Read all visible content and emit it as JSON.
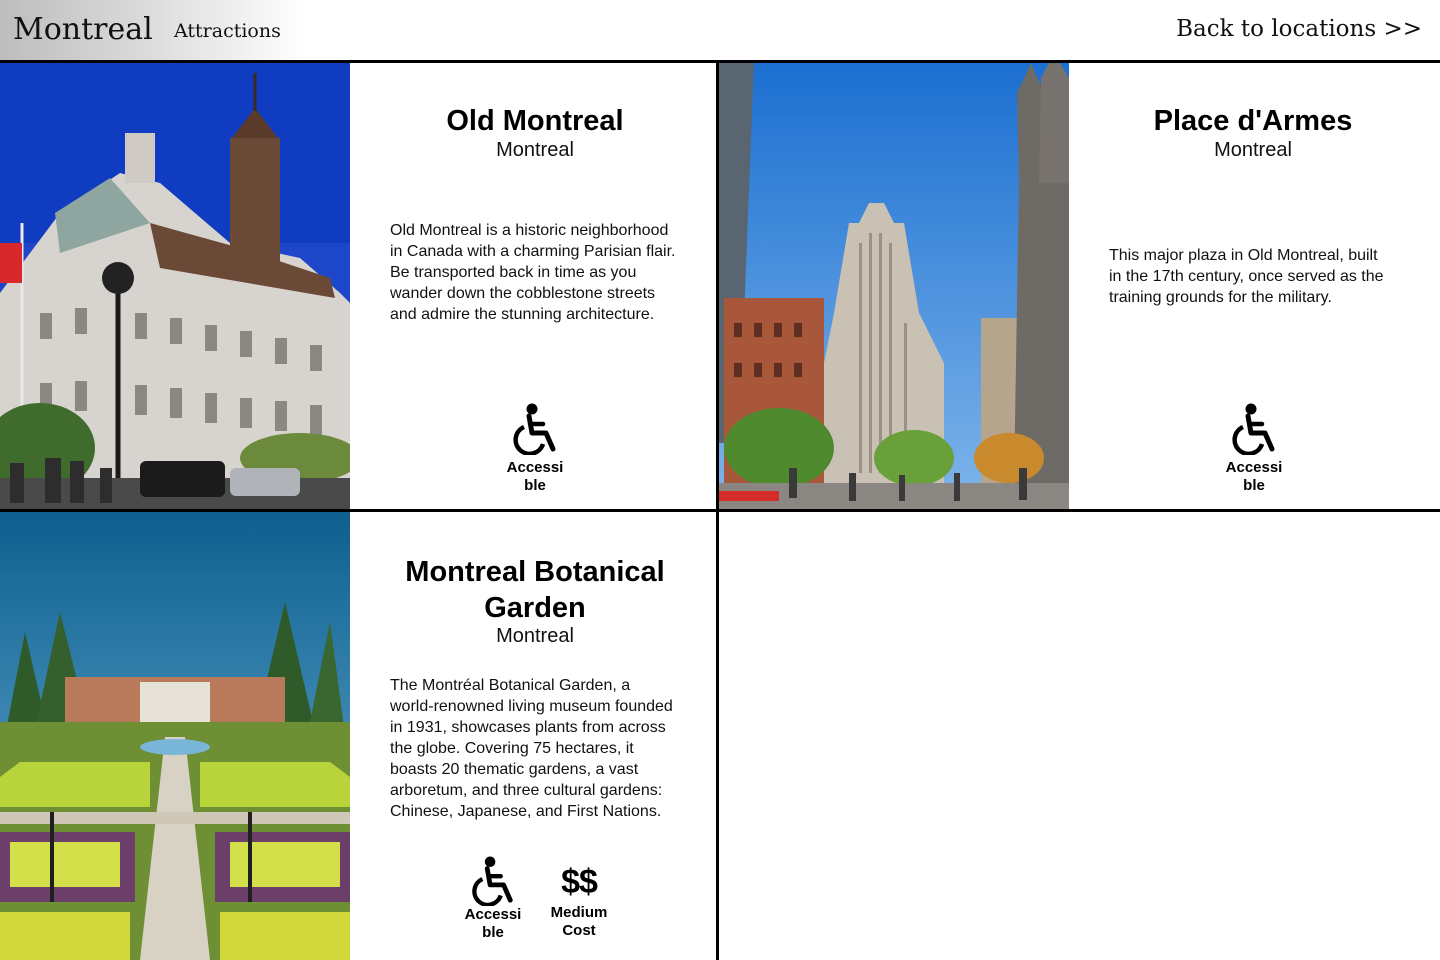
{
  "header": {
    "title": "Montreal",
    "subtitle": "Attractions",
    "back_link": "Back to locations >>"
  },
  "attractions": [
    {
      "title": "Old Montreal",
      "city": "Montreal",
      "description": "Old Montreal is a historic neighborhood in Canada with a charming Parisian flair. Be transported back in time as you wander down the cobblestone streets and admire the stunning architecture.",
      "badges": [
        {
          "icon": "wheelchair-icon",
          "label": "Accessible"
        }
      ]
    },
    {
      "title": "Place d'Armes",
      "city": "Montreal",
      "description": "This major plaza in Old Montreal, built in the 17th century, once served as the training grounds for the military.",
      "badges": [
        {
          "icon": "wheelchair-icon",
          "label": "Accessible"
        }
      ]
    },
    {
      "title": "Montreal Botanical Garden",
      "city": "Montreal",
      "description": "The Montréal Botanical Garden, a world-renowned living museum founded in 1931, showcases plants from across the globe. Covering 75 hectares, it boasts 20 thematic gardens, a vast arboretum, and three cultural gardens: Chinese, Japanese, and First Nations.",
      "badges": [
        {
          "icon": "wheelchair-icon",
          "label": "Accessible"
        },
        {
          "icon": "dollar-icon",
          "symbol": "$$",
          "label": "Medium Cost"
        }
      ]
    }
  ],
  "colors": {
    "header_gradient_start": "#bdbdbd",
    "divider": "#000000"
  }
}
